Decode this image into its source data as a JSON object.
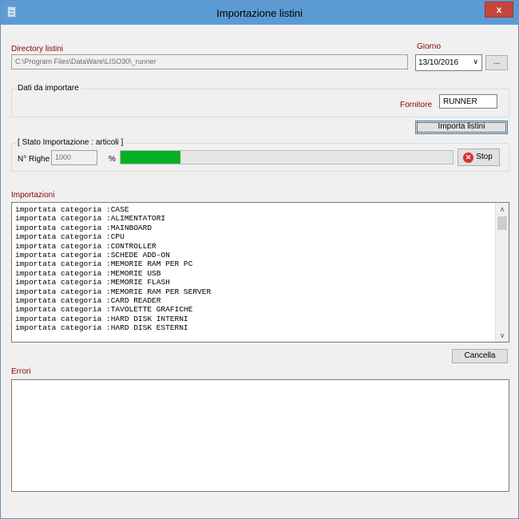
{
  "window": {
    "title": "Importazione listini",
    "close_label": "x"
  },
  "directory": {
    "label": "Directory listini",
    "value": "C:\\Program Files\\DataWare\\LISO30\\_runner"
  },
  "giorno": {
    "label": "Giorno",
    "value": "13/10/2016",
    "browse_label": "..."
  },
  "dati": {
    "label": "Dati da importare",
    "fornitore_label": "Fornitore",
    "fornitore_value": "RUNNER"
  },
  "import_button": "Importa listini",
  "stato": {
    "label": "[ Stato Importazione : articoli ]",
    "righe_label": "N° Righe",
    "righe_value": "1000",
    "percent_symbol": "%",
    "progress": 0.18,
    "stop_label": "Stop"
  },
  "importazioni": {
    "label": "Importazioni",
    "items": [
      "importata categoria :CASE",
      "importata categoria :ALIMENTATORI",
      "importata categoria :MAINBOARD",
      "importata categoria :CPU",
      "importata categoria :CONTROLLER",
      "importata categoria :SCHEDE ADD-ON",
      "importata categoria :MEMORIE RAM PER PC",
      "importata categoria :MEMORIE USB",
      "importata categoria :MEMORIE FLASH",
      "importata categoria :MEMORIE RAM PER SERVER",
      "importata categoria :CARD READER",
      "importata categoria :TAVOLETTE GRAFICHE",
      "importata categoria :HARD DISK INTERNI",
      "importata categoria :HARD DISK ESTERNI"
    ]
  },
  "cancella_button": "Cancella",
  "errori": {
    "label": "Errori"
  },
  "colors": {
    "titlebar": "#5b9bd5",
    "label_red": "#8b0000",
    "progress_fill": "#06b025",
    "close": "#c7453a"
  }
}
